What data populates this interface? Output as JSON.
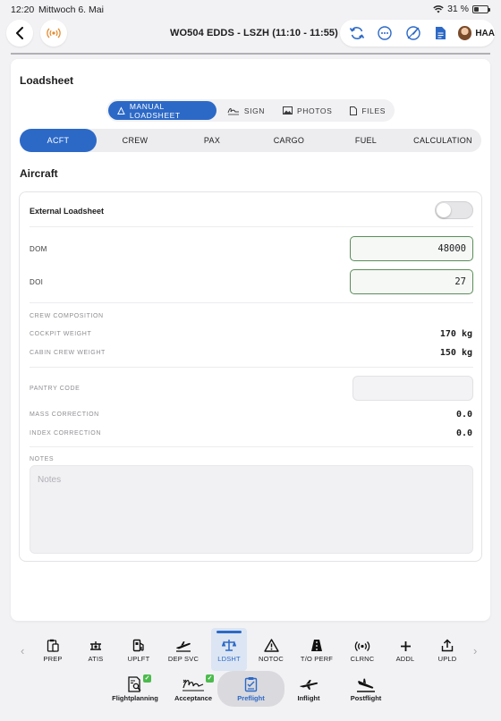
{
  "status_bar": {
    "time": "12:20",
    "date": "Mittwoch 6. Mai",
    "battery": "31 %"
  },
  "header": {
    "flight_title": "WO504 EDDS - LSZH (11:10 - 11:55)",
    "user_code": "HAA"
  },
  "loadsheet": {
    "title": "Loadsheet",
    "segments": [
      "MANUAL LOADSHEET",
      "SIGN",
      "PHOTOS",
      "FILES"
    ],
    "tabs": [
      "ACFT",
      "CREW",
      "PAX",
      "CARGO",
      "FUEL",
      "CALCULATION"
    ],
    "active_tab": "ACFT"
  },
  "aircraft": {
    "title": "Aircraft",
    "external_loadsheet_label": "External Loadsheet",
    "external_loadsheet_on": false,
    "dom_label": "DOM",
    "dom_value": "48000",
    "doi_label": "DOI",
    "doi_value": "27",
    "crew_composition_label": "CREW COMPOSITION",
    "cockpit_weight_label": "COCKPIT WEIGHT",
    "cockpit_weight_value": "170 kg",
    "cabin_crew_weight_label": "CABIN CREW WEIGHT",
    "cabin_crew_weight_value": "150 kg",
    "pantry_code_label": "PANTRY CODE",
    "pantry_code_value": "",
    "mass_correction_label": "MASS CORRECTION",
    "mass_correction_value": "0.0",
    "index_correction_label": "INDEX CORRECTION",
    "index_correction_value": "0.0",
    "notes_label": "NOTES",
    "notes_placeholder": "Notes"
  },
  "modules": [
    {
      "label": "PREP",
      "icon": "clipboard-icon"
    },
    {
      "label": "ATIS",
      "icon": "atis-icon"
    },
    {
      "label": "UPLFT",
      "icon": "fuel-pump-icon"
    },
    {
      "label": "DEP SVC",
      "icon": "departure-plane-icon"
    },
    {
      "label": "LDSHT",
      "icon": "scale-icon"
    },
    {
      "label": "NOTOC",
      "icon": "warning-icon"
    },
    {
      "label": "T/O PERF",
      "icon": "runway-icon"
    },
    {
      "label": "CLRNC",
      "icon": "radio-icon"
    },
    {
      "label": "ADDL",
      "icon": "plus-icon"
    },
    {
      "label": "UPLD",
      "icon": "upload-icon"
    }
  ],
  "active_module": "LDSHT",
  "phases": [
    {
      "label": "Flightplanning",
      "icon": "document-search-icon",
      "done": true
    },
    {
      "label": "Acceptance",
      "icon": "signature-icon",
      "done": true
    },
    {
      "label": "Preflight",
      "icon": "checklist-icon",
      "done": false
    },
    {
      "label": "Inflight",
      "icon": "plane-icon",
      "done": false
    },
    {
      "label": "Postflight",
      "icon": "landing-icon",
      "done": false
    }
  ],
  "active_phase": "Preflight",
  "colors": {
    "accent": "#2c69c7",
    "check": "#4cbb4c",
    "input_border": "#5b8d5b"
  }
}
